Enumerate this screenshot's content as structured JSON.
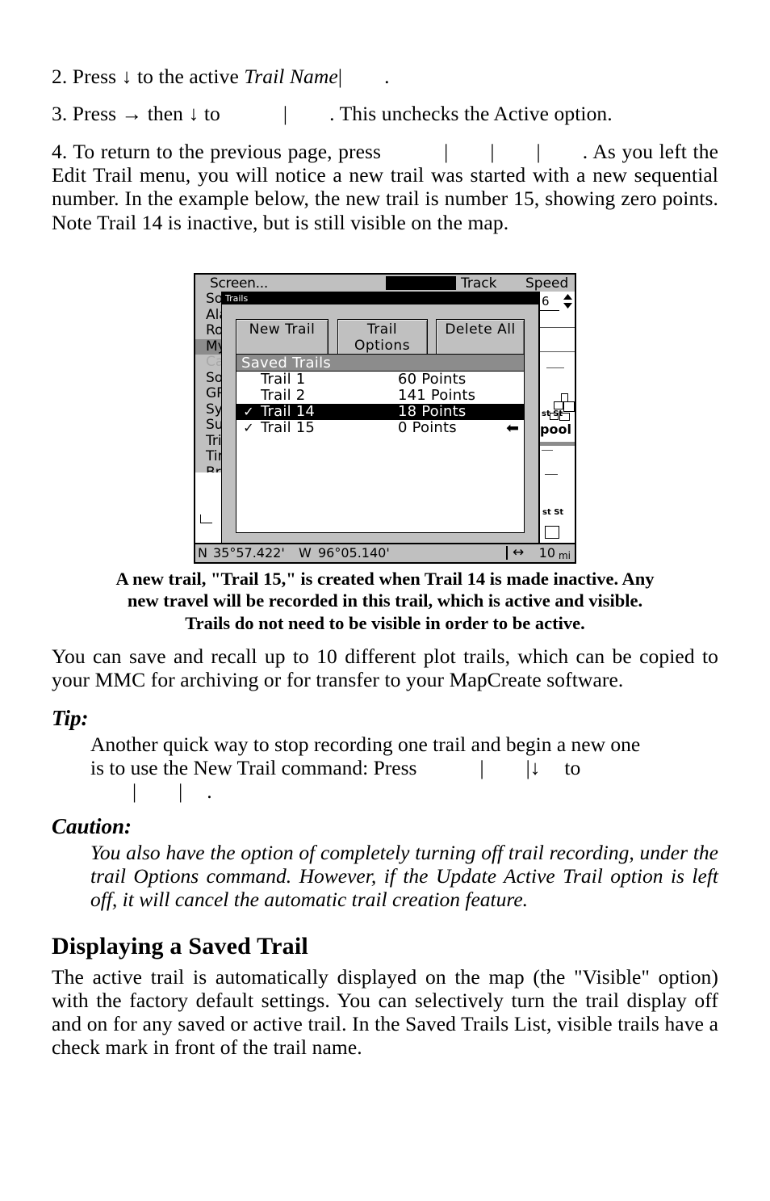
{
  "document": {
    "steps": [
      {
        "id": "step-2",
        "parts": [
          {
            "t": "2. Press ",
            "style": "normal"
          },
          {
            "t": "↓",
            "style": "normal"
          },
          {
            "t": " to the active ",
            "style": "normal"
          },
          {
            "t": "Trail Name",
            "style": "italic"
          },
          {
            "t": "|",
            "style": "normal"
          },
          {
            "t": "gap",
            "style": "gap"
          },
          {
            "t": ".",
            "style": "normal"
          }
        ],
        "plain": "2. Press ↓ to the active Trail Name| ."
      },
      {
        "id": "step-3",
        "plain": "3. Press → then ↓ to | . This unchecks the Active option."
      },
      {
        "id": "step-4",
        "plain": "4. To return to the previous page, press | | | . As you left the Edit Trail menu, you will notice a new trail was started with a new sequential number. In the example below, the new trail is number 15, showing zero points. Note Trail 14 is inactive, but is still visible on the map."
      }
    ],
    "step2": {
      "lead": "2. Press ",
      "arrow_down": "↓",
      "mid": " to the active ",
      "italic_term": "Trail Name",
      "bar": "|",
      "tail": "."
    },
    "step3": {
      "lead": "3. Press ",
      "arrow_right": "→",
      "mid": " then ",
      "arrow_down": "↓",
      "mid2": " to",
      "bar": "|",
      "tail": ". This unchecks the Active option."
    },
    "step4": {
      "lead": "4. To return to the previous page, press",
      "bar1": "|",
      "bar2": "|",
      "bar3": "|",
      "tail": ". As you left the Edit Trail menu, you will notice a new trail was started with a new sequential number. In the example below, the new trail is number 15, showing zero points. Note Trail 14 is inactive, but is still visible on the map."
    },
    "caption": {
      "line1": "A new trail, \"Trail 15,\" is created when Trail 14 is made inactive. Any",
      "line2": "new travel will be recorded in this trail, which is active and visible.",
      "line3": "Trails do not need to be visible in order to be active."
    },
    "paragraph_save_recall": "You can save and recall up to 10 different plot trails, which can be copied to your MMC for archiving or for transfer to your MapCreate software.",
    "tip": {
      "label": "Tip:",
      "line1": "Another quick way to stop recording one trail and begin a new one",
      "line2a": "is to use the New Trail command: Press",
      "bar1": "|",
      "bar2": "|",
      "arrow_down": "↓",
      "line2b": "to",
      "bar3": "|",
      "bar4": "|",
      "tail": "."
    },
    "caution": {
      "label": "Caution:",
      "text": "You also have the option of completely turning off trail recording, under the trail Options command. However, if the Update Active Trail option is left off, it will cancel the automatic trail creation feature."
    },
    "section_heading": "Displaying a Saved Trail",
    "paragraph_displaying": "The active trail is automatically displayed on the map (the \"Visible\" option) with the factory default settings. You can selectively turn the trail display off and on for any saved or active trail. In the Saved Trails List, visible trails have a check mark in front of the trail name."
  },
  "gps_screen": {
    "menu_bar": {
      "screen_item": "Screen...",
      "track_label": "Track",
      "speed_label": "Speed"
    },
    "sidebar_items": [
      {
        "label": "So",
        "state": "normal"
      },
      {
        "label": "Ala",
        "state": "normal"
      },
      {
        "label": "Ro",
        "state": "normal"
      },
      {
        "label": "My",
        "state": "selected"
      },
      {
        "label": "Ca",
        "state": "disabled"
      },
      {
        "label": "So",
        "state": "normal"
      },
      {
        "label": "GP",
        "state": "normal"
      },
      {
        "label": "Sy",
        "state": "normal"
      },
      {
        "label": "Su",
        "state": "normal"
      },
      {
        "label": "Tri",
        "state": "normal"
      },
      {
        "label": "Tin",
        "state": "normal"
      },
      {
        "label": "Brc",
        "state": "normal"
      }
    ],
    "right_panel": {
      "field_value": "6",
      "spinner": "▲▼",
      "map_labels": [
        "st St",
        "pool",
        "st St"
      ]
    },
    "dialog": {
      "title": "Trails",
      "buttons": [
        {
          "label": "New Trail",
          "name": "new-trail-button"
        },
        {
          "label": "Trail Options",
          "name": "trail-options-button"
        },
        {
          "label": "Delete All",
          "name": "delete-all-button"
        }
      ],
      "list_header": "Saved Trails",
      "rows": [
        {
          "check": "",
          "name": "Trail 1",
          "points": "60 Points",
          "highlighted": false,
          "pointer": ""
        },
        {
          "check": "",
          "name": "Trail 2",
          "points": "141 Points",
          "highlighted": false,
          "pointer": ""
        },
        {
          "check": "✓",
          "name": "Trail 14",
          "points": "18 Points",
          "highlighted": true,
          "pointer": ""
        },
        {
          "check": "✓",
          "name": "Trail 15",
          "points": "0 Points",
          "highlighted": false,
          "pointer": "⬅"
        }
      ]
    },
    "status_bar": {
      "lat_hemisphere": "N",
      "latitude": "35°57.422'",
      "lon_hemisphere": "W",
      "longitude": "96°05.140'",
      "scale_icon": "↔",
      "scale_value": "10",
      "scale_unit": "mi"
    }
  },
  "colors": {
    "page_bg": "#ffffff",
    "text": "#000000",
    "gps_chrome": "#c0c0c0",
    "gps_highlight": "#000000",
    "gps_header_gray": "#8c8c8c",
    "gps_disabled": "#a8a8a8",
    "gps_list_bg": "#ffffff"
  }
}
